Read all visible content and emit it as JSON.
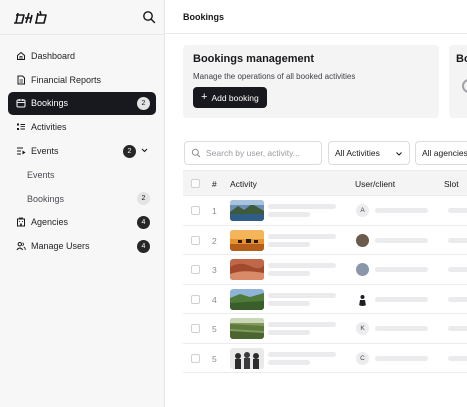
{
  "sidebar": {
    "logo_text": "dxb",
    "items": [
      {
        "label": "Dashboard",
        "icon": "home-icon"
      },
      {
        "label": "Financial Reports",
        "icon": "file-report-icon"
      },
      {
        "label": "Bookings",
        "icon": "calendar-icon",
        "badge": "2",
        "active": true
      },
      {
        "label": "Activities",
        "icon": "list-icon"
      },
      {
        "label": "Events",
        "icon": "list-play-icon",
        "badge": "2",
        "expanded": true
      },
      {
        "label": "Events",
        "sub": true
      },
      {
        "label": "Bookings",
        "sub": true,
        "badge": "2"
      },
      {
        "label": "Agencies",
        "icon": "building-icon",
        "badge": "4"
      },
      {
        "label": "Manage Users",
        "icon": "users-icon",
        "badge": "4"
      }
    ]
  },
  "header": {
    "title": "Bookings"
  },
  "management_card": {
    "title": "Bookings management",
    "description": "Manage the operations of all booked activities",
    "add_button": "Add booking"
  },
  "second_card": {
    "title_partial": "Bo"
  },
  "filters": {
    "search_placeholder": "Search by user, activity...",
    "activities_select": "All Activities",
    "agencies_select": "All agencies"
  },
  "table": {
    "columns": [
      "#",
      "Activity",
      "User/client",
      "Slot"
    ],
    "rows": [
      {
        "num": "1",
        "thumb": "mountain-lake",
        "avatar_letter": "A"
      },
      {
        "num": "2",
        "thumb": "sunset-camels",
        "avatar_letter": ""
      },
      {
        "num": "3",
        "thumb": "red-desert",
        "avatar_letter": ""
      },
      {
        "num": "4",
        "thumb": "forest-valley",
        "avatar_letter": ""
      },
      {
        "num": "5",
        "thumb": "green-canyon",
        "avatar_letter": "K"
      },
      {
        "num": "5",
        "thumb": "group-people",
        "avatar_letter": "C"
      }
    ]
  },
  "colors": {
    "sidebar_bg": "#f7f7f8",
    "accent": "#18181f",
    "card_bg": "#f4f4f5"
  }
}
